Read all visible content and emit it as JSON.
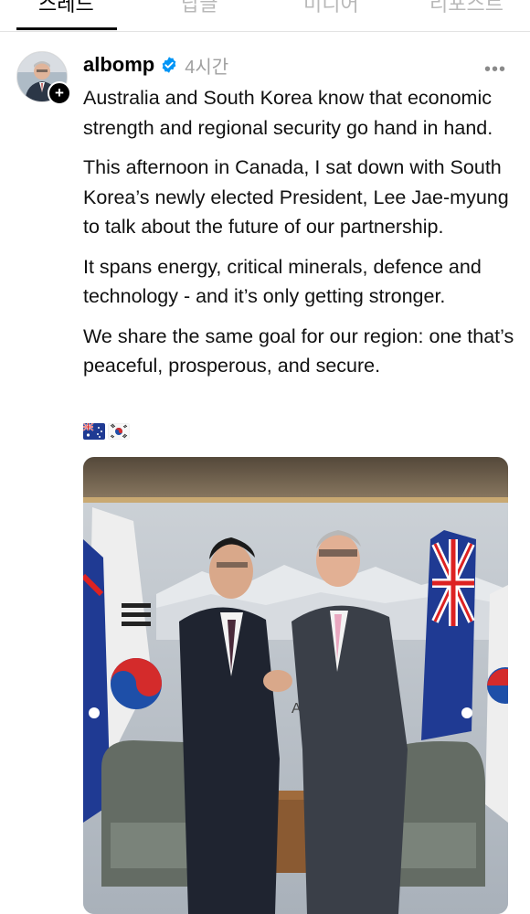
{
  "tabs": [
    {
      "label": "스레드",
      "active": true
    },
    {
      "label": "답글",
      "active": false
    },
    {
      "label": "미디어",
      "active": false
    },
    {
      "label": "리포스트",
      "active": false
    }
  ],
  "post": {
    "username": "albomp",
    "verified": true,
    "time": "4시간",
    "more_label": "•••",
    "add_badge": "+",
    "paragraphs": [
      "Australia and South Korea know that economic strength and regional security go hand in hand.",
      "This afternoon in Canada, I sat down with South Korea’s newly elected President, Lee Jae-myung to talk about the future of our partnership.",
      "It spans energy, critical minerals, defence and technology - and it’s only getting stronger.",
      "We share the same goal for our region: one that’s peaceful, prosperous, and secure."
    ],
    "flag_icons": [
      "australia-flag-icon",
      "south-korea-flag-icon"
    ]
  },
  "photo_backdrop_text": "AN",
  "colors": {
    "verified": "#0095f6",
    "muted": "#a0a0a0",
    "text": "#111111"
  }
}
